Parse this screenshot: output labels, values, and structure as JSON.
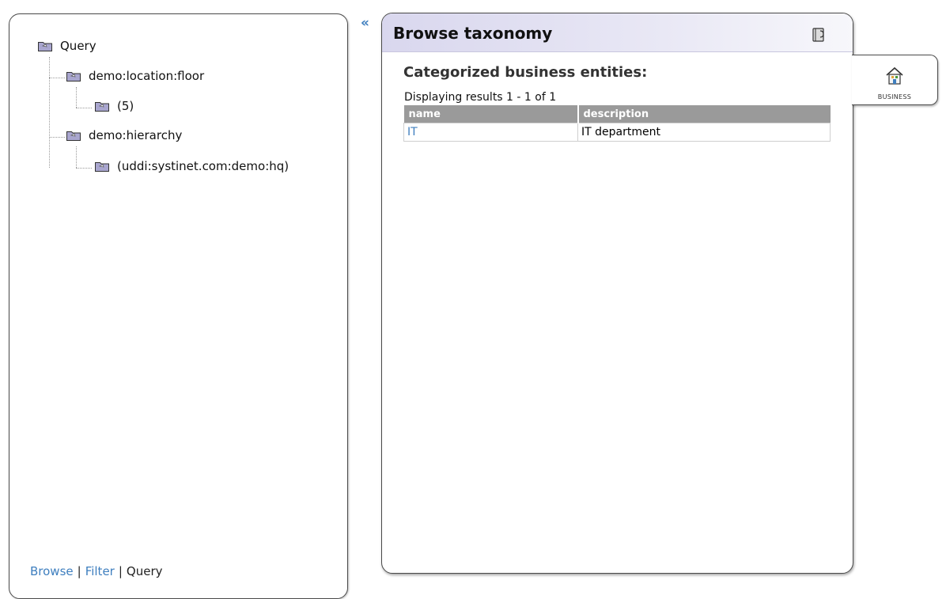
{
  "nav": {
    "collapse_glyph": "«"
  },
  "tree": {
    "items": [
      {
        "label": "Query",
        "icon": "folder-icon"
      },
      {
        "label": "demo:location:floor",
        "icon": "folder-icon"
      },
      {
        "label": "(5)",
        "icon": "folder-icon"
      },
      {
        "label": "demo:hierarchy",
        "icon": "folder-icon"
      },
      {
        "label": "(uddi:systinet.com:demo:hq)",
        "icon": "folder-icon"
      }
    ]
  },
  "panel_links": {
    "browse": "Browse",
    "filter": "Filter",
    "query": "Query",
    "separator": "|"
  },
  "main": {
    "title": "Browse taxonomy",
    "section_title": "Categorized business entities:",
    "results_summary": "Displaying results 1 - 1 of 1",
    "columns": [
      "name",
      "description"
    ],
    "rows": [
      {
        "name": "IT",
        "description": "IT department"
      }
    ]
  },
  "side_tab": {
    "label": "BUSINESS",
    "icon": "business-house-icon"
  },
  "colors": {
    "link": "#3f7fbf",
    "header_gradient_start": "#d9d7ee",
    "table_header": "#9a9a9a",
    "folder_fill": "#a9a6cf"
  }
}
